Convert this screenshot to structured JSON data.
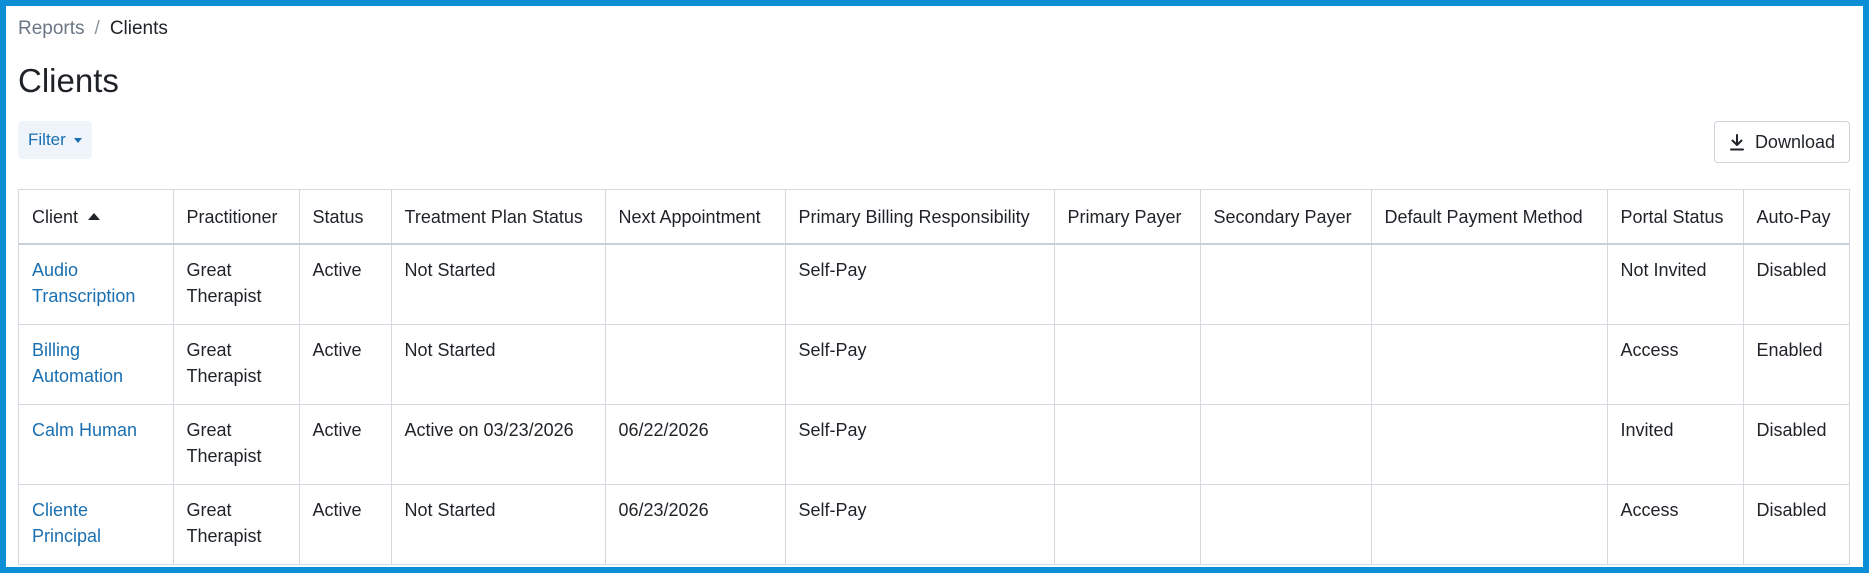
{
  "breadcrumb": {
    "parent": "Reports",
    "separator": "/",
    "current": "Clients"
  },
  "page_title": "Clients",
  "filter_label": "Filter",
  "download_label": "Download",
  "table": {
    "headers": [
      "Client",
      "Practitioner",
      "Status",
      "Treatment Plan Status",
      "Next Appointment",
      "Primary Billing Responsibility",
      "Primary Payer",
      "Secondary Payer",
      "Default Payment Method",
      "Portal Status",
      "Auto-Pay"
    ],
    "rows": [
      [
        "Audio Transcription",
        "Great Therapist",
        "Active",
        "Not Started",
        "",
        "Self-Pay",
        "",
        "",
        "",
        "Not Invited",
        "Disabled"
      ],
      [
        "Billing Automation",
        "Great Therapist",
        "Active",
        "Not Started",
        "",
        "Self-Pay",
        "",
        "",
        "",
        "Access",
        "Enabled"
      ],
      [
        "Calm Human",
        "Great Therapist",
        "Active",
        "Active on 03/23/2026",
        "06/22/2026",
        "Self-Pay",
        "",
        "",
        "",
        "Invited",
        "Disabled"
      ],
      [
        "Cliente Principal",
        "Great Therapist",
        "Active",
        "Not Started",
        "06/23/2026",
        "Self-Pay",
        "",
        "",
        "",
        "Access",
        "Disabled"
      ]
    ]
  },
  "colors": {
    "link": "#1a6fb0",
    "frame": "#0d8fd6"
  },
  "icons": {
    "sort": "sort-ascending-icon",
    "filter": "caret-down-icon",
    "download": "download-icon"
  }
}
